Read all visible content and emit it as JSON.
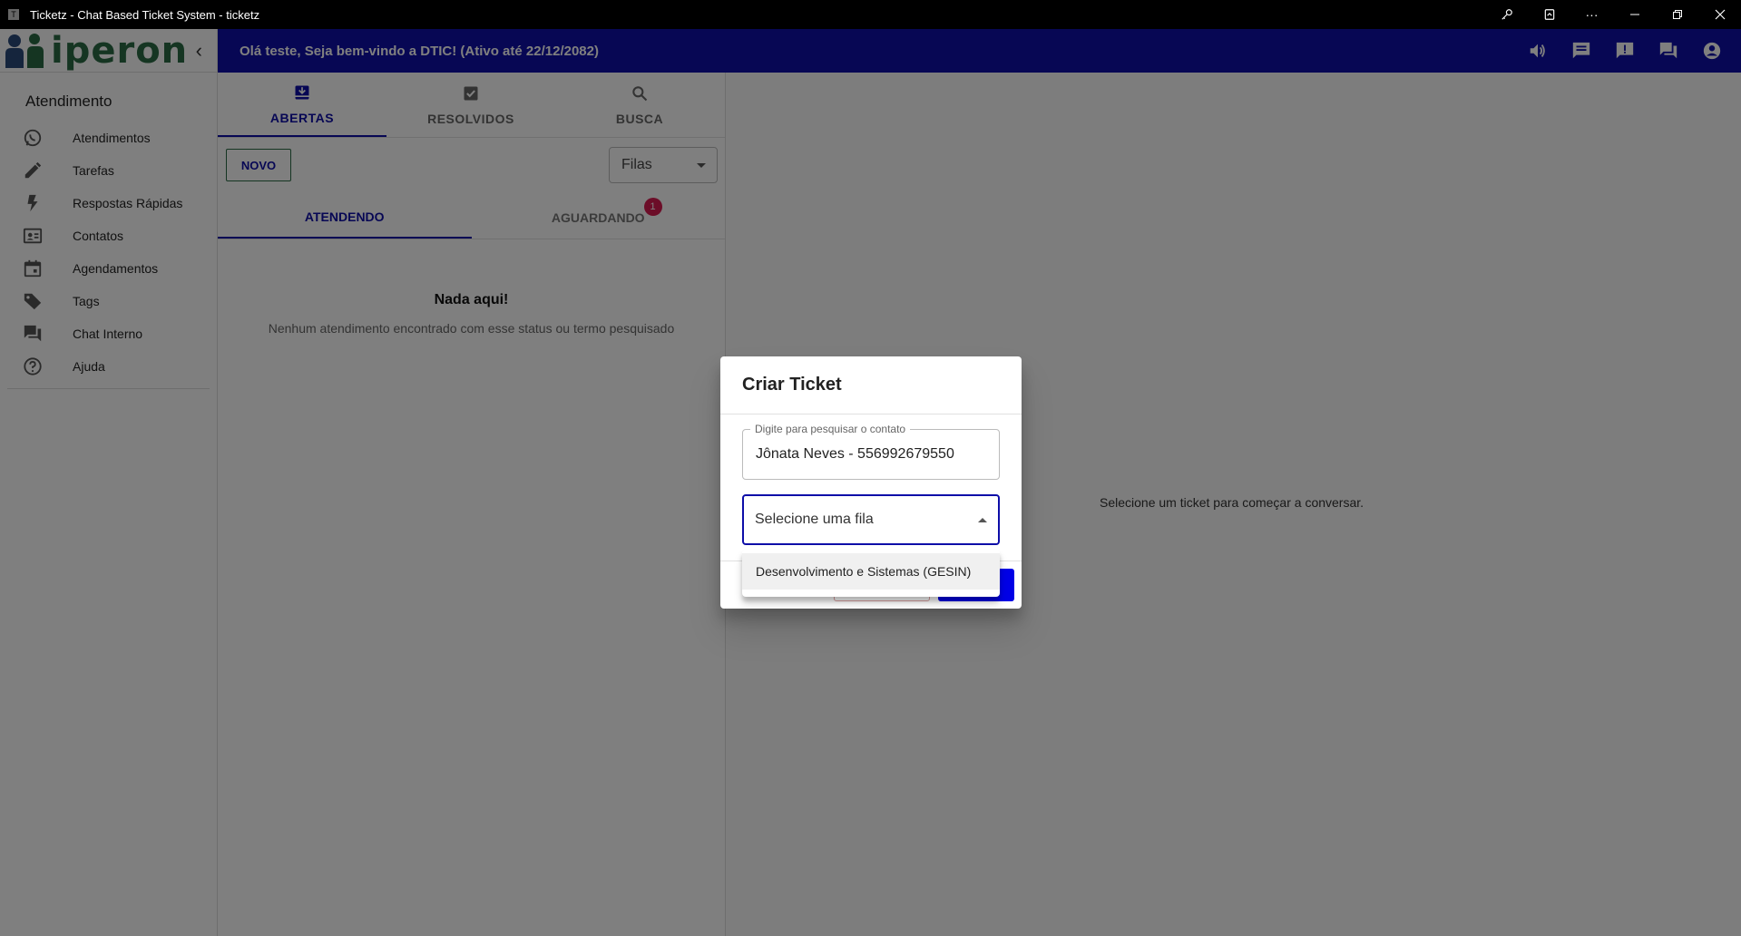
{
  "window": {
    "title": "Ticketz - Chat Based Ticket System - ticketz",
    "app_icon_letter": "T"
  },
  "topbar": {
    "welcome": "Olá teste, Seja bem-vindo a DTIC! (Ativo até 22/12/2082)",
    "icons": [
      "volume-icon",
      "chat-icon",
      "announcement-icon",
      "forum-icon",
      "account-icon"
    ]
  },
  "sidebar": {
    "logo_text": "iperon",
    "section_title": "Atendimento",
    "items": [
      {
        "label": "Atendimentos",
        "icon": "whatsapp-icon"
      },
      {
        "label": "Tarefas",
        "icon": "pencil-icon"
      },
      {
        "label": "Respostas Rápidas",
        "icon": "flash-icon"
      },
      {
        "label": "Contatos",
        "icon": "contacts-icon"
      },
      {
        "label": "Agendamentos",
        "icon": "calendar-icon"
      },
      {
        "label": "Tags",
        "icon": "tag-icon"
      },
      {
        "label": "Chat Interno",
        "icon": "forum-icon"
      },
      {
        "label": "Ajuda",
        "icon": "help-icon"
      }
    ]
  },
  "tickets": {
    "tabs": [
      {
        "label": "ABERTAS",
        "icon": "move-to-inbox-icon",
        "active": true
      },
      {
        "label": "RESOLVIDOS",
        "icon": "check-box-icon",
        "active": false
      },
      {
        "label": "BUSCA",
        "icon": "search-icon",
        "active": false
      }
    ],
    "new_button": "NOVO",
    "queue_filter": "Filas",
    "subtabs": [
      {
        "label": "ATENDENDO",
        "active": true
      },
      {
        "label": "AGUARDANDO",
        "active": false,
        "badge": "1"
      }
    ],
    "empty_title": "Nada aqui!",
    "empty_subtitle": "Nenhum atendimento encontrado com esse status ou termo pesquisado"
  },
  "chat": {
    "placeholder": "Selecione um ticket para começar a conversar."
  },
  "dialog": {
    "title": "Criar Ticket",
    "contact_label": "Digite para pesquisar o contato",
    "contact_value": "Jônata Neves - 556992679550",
    "queue_placeholder": "Selecione uma fila",
    "queue_options": [
      "Desenvolvimento e Sistemas (GESIN)"
    ]
  },
  "colors": {
    "primary": "#0e0ea8",
    "brand_green": "#2b6a44",
    "badge": "#d81b50",
    "save_button": "#0000e6"
  }
}
